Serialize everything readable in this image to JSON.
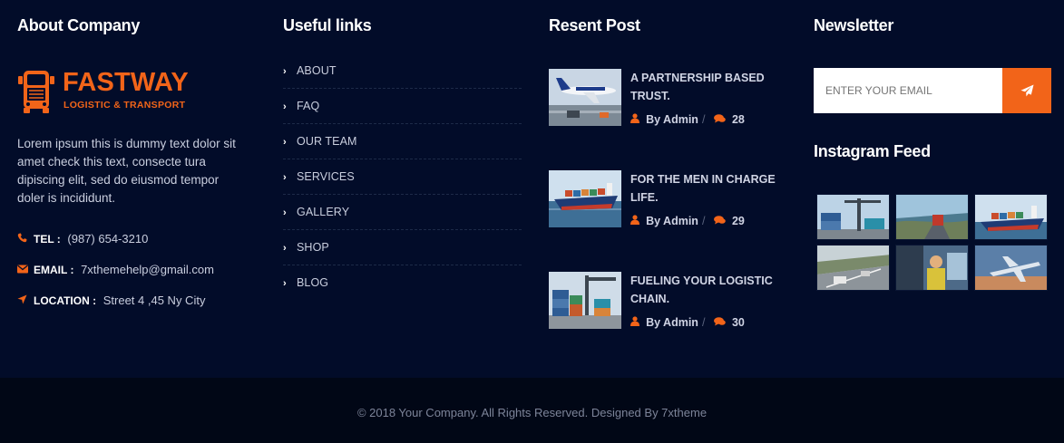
{
  "about": {
    "title": "About Company",
    "logo_name": "FASTWAY",
    "logo_tag": "LOGISTIC & TRANSPORT",
    "text": "Lorem ipsum this is dummy text dolor sit amet check this text, consecte tura dipiscing elit, sed do eiusmod tempor doler is incididunt.",
    "contacts": [
      {
        "icon": "phone-icon",
        "label": "TEL :",
        "value": "(987) 654-3210"
      },
      {
        "icon": "envelope-icon",
        "label": "EMAIL :",
        "value": "7xthemehelp@gmail.com"
      },
      {
        "icon": "location-arrow-icon",
        "label": "LOCATION :",
        "value": "Street 4 ,45 Ny City"
      }
    ]
  },
  "links": {
    "title": "Useful links",
    "items": [
      "ABOUT",
      "FAQ",
      "OUR TEAM",
      "SERVICES",
      "GALLERY",
      "SHOP",
      "BLOG"
    ]
  },
  "posts": {
    "title": "Resent Post",
    "items": [
      {
        "title": "A PARTNERSHIP BASED TRUST.",
        "author": "By Admin",
        "comments": "28",
        "thumb": "airplane-image"
      },
      {
        "title": "FOR THE MEN IN CHARGE LIFE.",
        "author": "By Admin",
        "comments": "29",
        "thumb": "cargo-ship-image"
      },
      {
        "title": "FUELING YOUR LOGISTIC CHAIN.",
        "author": "By Admin",
        "comments": "30",
        "thumb": "container-port-image"
      }
    ]
  },
  "newsletter": {
    "title": "Newsletter",
    "placeholder": "ENTER YOUR EMAIL",
    "submit_icon": "paper-plane-icon"
  },
  "instagram": {
    "title": "Instagram Feed",
    "items": [
      "container-crane-image",
      "coastal-road-truck-image",
      "cargo-ship-image",
      "highway-traffic-image",
      "truck-driver-image",
      "airplane-sky-image"
    ]
  },
  "footer": {
    "copyright": "© 2018 Your Company. All Rights Reserved. Designed By 7xtheme"
  },
  "colors": {
    "background": "#020c29",
    "bottom_bar": "#010716",
    "accent": "#f26419"
  }
}
